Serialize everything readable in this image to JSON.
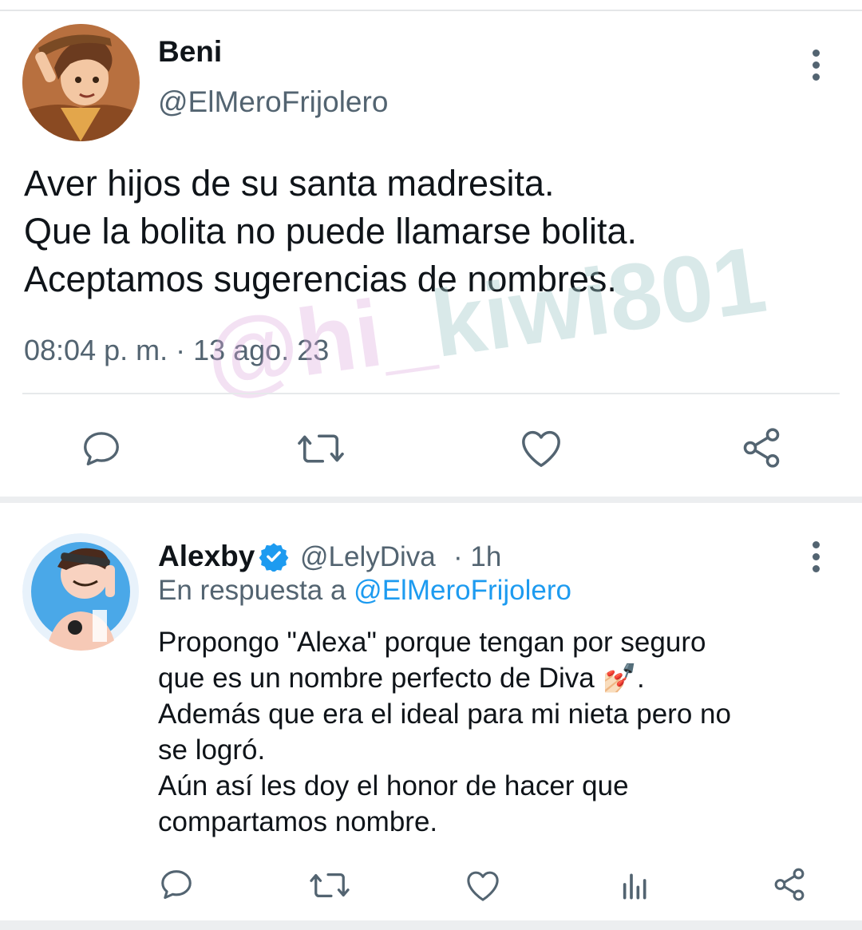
{
  "tweet": {
    "author_name": "Beni",
    "author_handle": "@ElMeroFrijolero",
    "text_lines": [
      "Aver hijos de su santa madresita.",
      "Que la bolita no puede llamarse bolita.",
      "Aceptamos sugerencias de nombres."
    ],
    "timestamp": "08:04 p. m. · 13 ago. 23"
  },
  "watermark": {
    "part1": "@hi_",
    "part2": "kiwi801"
  },
  "reply": {
    "author_name": "Alexby",
    "author_handle": "@LelyDiva",
    "time": "· 1h",
    "replying_prefix": "En respuesta a",
    "replying_to": "@ElMeroFrijolero",
    "text_lines": [
      "Propongo \"Alexa\" porque tengan  por seguro",
      "que es un nombre perfecto de Diva 💅🏻.",
      "Además que era el ideal para mi nieta pero no",
      "se logró.",
      "Aún así les doy el honor de hacer que",
      "compartamos nombre."
    ]
  },
  "icons": {
    "reply": "reply-icon",
    "retweet": "retweet-icon",
    "like": "like-icon",
    "share": "share-icon",
    "analytics": "analytics-icon",
    "more": "more-options-icon",
    "verified": "verified-badge-icon"
  },
  "colors": {
    "text": "#0f1419",
    "secondary": "#536471",
    "accent": "#1d9bf0"
  }
}
